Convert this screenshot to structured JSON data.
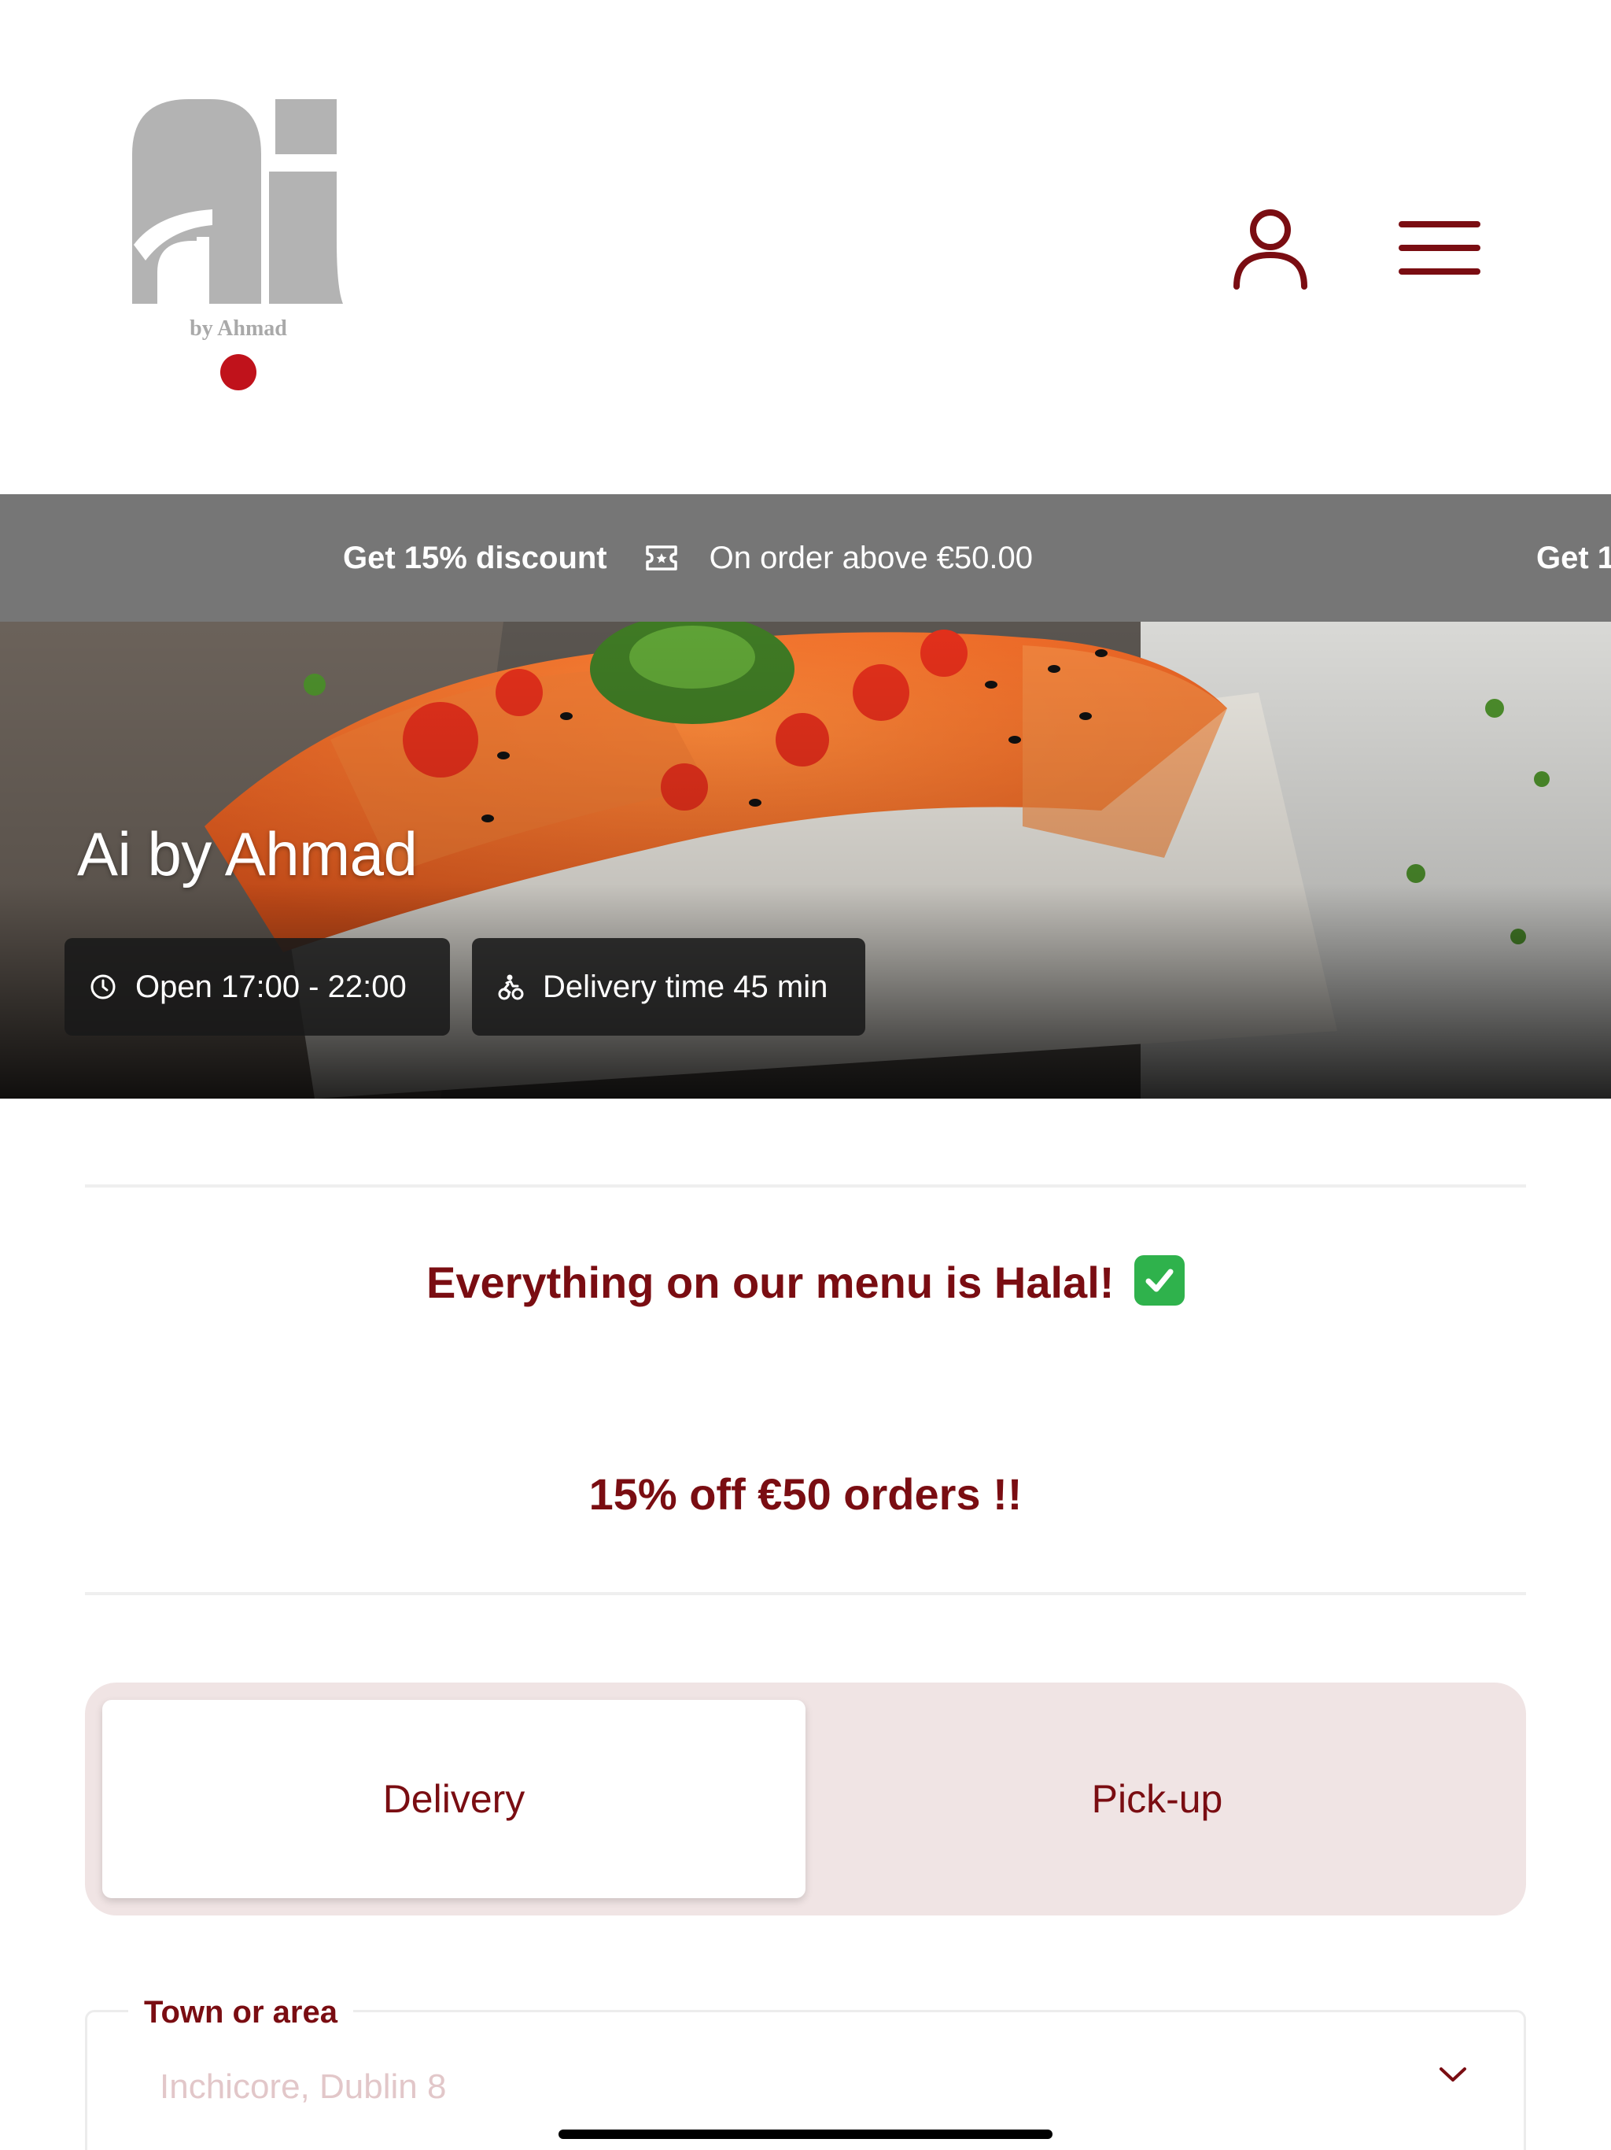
{
  "logo": {
    "sub_text": "by Ahmad"
  },
  "header": {
    "account_icon": "user-icon",
    "menu_icon": "hamburger-menu-icon"
  },
  "promo": {
    "headline": "Get 15% discount",
    "icon": "ticket-icon",
    "condition": "On order above €50.00",
    "repeat_headline": "Get 1"
  },
  "hero": {
    "title": "Ai by Ahmad",
    "open_hours": "Open 17:00 - 22:00",
    "delivery_time": "Delivery time 45 min",
    "open_icon": "clock-icon",
    "delivery_icon": "scooter-icon"
  },
  "notices": {
    "halal": "Everything on our menu is Halal!",
    "discount": "15% off €50 orders !!"
  },
  "order_type": {
    "delivery_label": "Delivery",
    "pickup_label": "Pick-up",
    "selected": "Delivery"
  },
  "town_field": {
    "label": "Town or area",
    "placeholder": "Inchicore, Dublin 8"
  },
  "colors": {
    "brand": "#7a0d12",
    "promo_bg": "#767676",
    "toggle_bg": "#f0e4e4",
    "logo_red": "#c0121b",
    "logo_grey": "#b3b3b3"
  }
}
